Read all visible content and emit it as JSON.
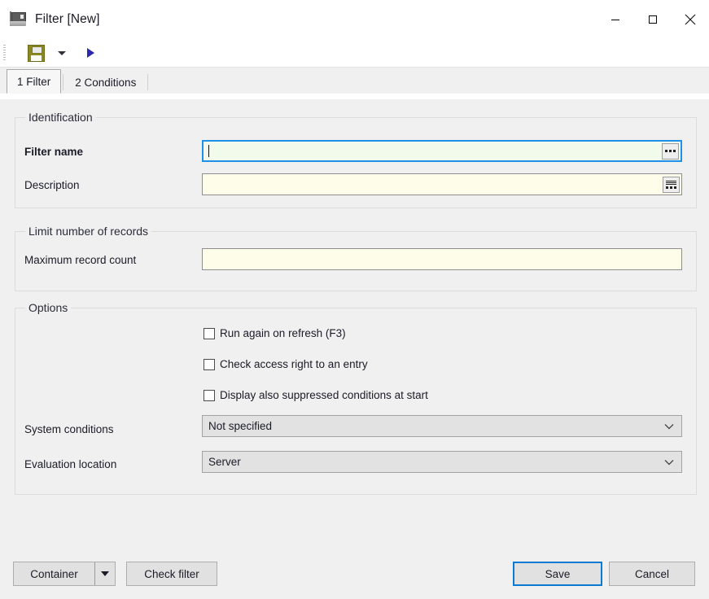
{
  "window": {
    "title": "Filter [New]",
    "icon": "k2-app-icon",
    "controls": {
      "minimize": "minimize-icon",
      "maximize": "maximize-icon",
      "close": "close-icon"
    }
  },
  "toolbar": {
    "save_icon": "floppy-save-icon",
    "save_dropdown_icon": "caret-down-icon",
    "run_icon": "run-play-icon"
  },
  "tabs": [
    {
      "label": "1 Filter",
      "active": true
    },
    {
      "label": "2 Conditions",
      "active": false
    }
  ],
  "groups": {
    "identification": {
      "title": "Identification",
      "filter_name": {
        "label": "Filter name",
        "value": "",
        "placeholder": "",
        "button_icon": "ellipsis-icon"
      },
      "description": {
        "label": "Description",
        "value": "",
        "placeholder": "",
        "button_icon": "memo-editor-icon"
      }
    },
    "limit_records": {
      "title": "Limit number of records",
      "maximum_record_count": {
        "label": "Maximum record count",
        "value": "",
        "placeholder": ""
      }
    },
    "options": {
      "title": "Options",
      "checkboxes": [
        {
          "label": "Run again on refresh (F3)",
          "checked": false
        },
        {
          "label": "Check access right to an entry",
          "checked": false
        },
        {
          "label": "Display also suppressed conditions at start",
          "checked": false
        }
      ],
      "system_conditions": {
        "label": "System conditions",
        "value": "Not specified",
        "options": [
          "Not specified"
        ]
      },
      "evaluation_location": {
        "label": "Evaluation location",
        "value": "Server",
        "options": [
          "Server"
        ]
      }
    }
  },
  "footer": {
    "container_button": "Container",
    "container_dropdown_icon": "caret-down-icon",
    "check_filter_button": "Check filter",
    "save_button": "Save",
    "cancel_button": "Cancel"
  },
  "colors": {
    "window_background": "#f0f0f0",
    "focus_blue": "#1e90e8",
    "input_yellow": "#fdfdea",
    "input_focused_green": "#f2faec",
    "save_icon_olive": "#8a8a20",
    "run_icon_blue": "#2a2ab0"
  }
}
